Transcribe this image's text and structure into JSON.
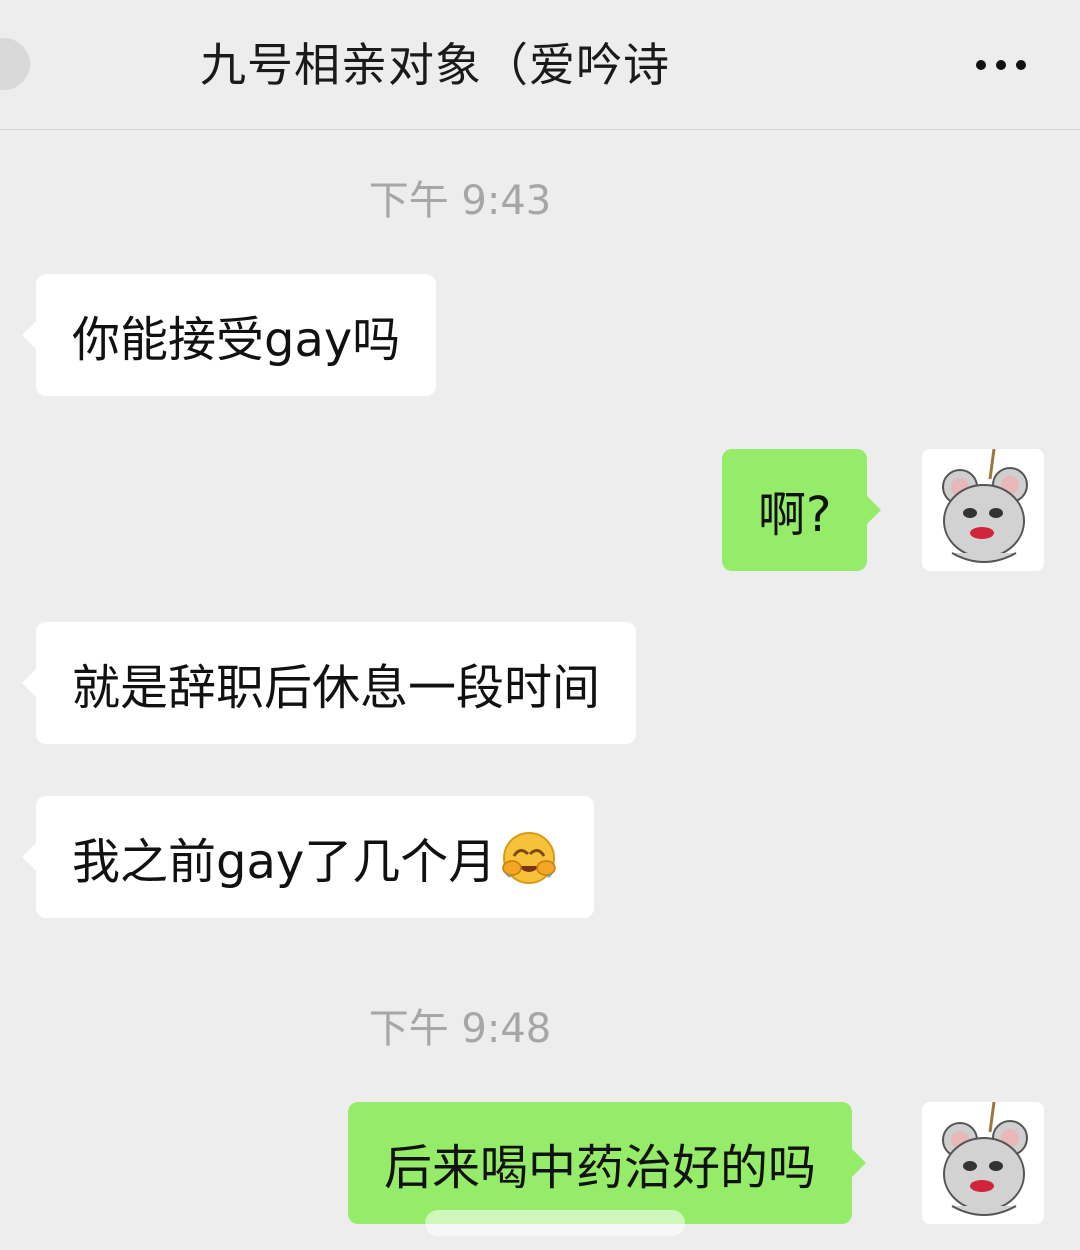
{
  "header": {
    "title": "九号相亲对象（爱吟诗",
    "more_icon": "more-dots-icon"
  },
  "messages": [
    {
      "type": "timestamp",
      "text": "下午 9:43"
    },
    {
      "type": "incoming",
      "text": "你能接受gay吗"
    },
    {
      "type": "outgoing",
      "text": "啊?",
      "avatar_icon": "mouse-avatar-icon"
    },
    {
      "type": "incoming",
      "text": "就是辞职后休息一段时间"
    },
    {
      "type": "incoming",
      "text": "我之前gay了几个月",
      "emoji": "crying-laughing-emoji-icon"
    },
    {
      "type": "timestamp",
      "text": "下午 9:48"
    },
    {
      "type": "outgoing",
      "text": "后来喝中药治好的吗",
      "avatar_icon": "mouse-avatar-icon"
    }
  ],
  "colors": {
    "background": "#ededed",
    "incoming_bubble": "#ffffff",
    "outgoing_bubble": "#95ec69",
    "timestamp_text": "#a6a6a6"
  }
}
